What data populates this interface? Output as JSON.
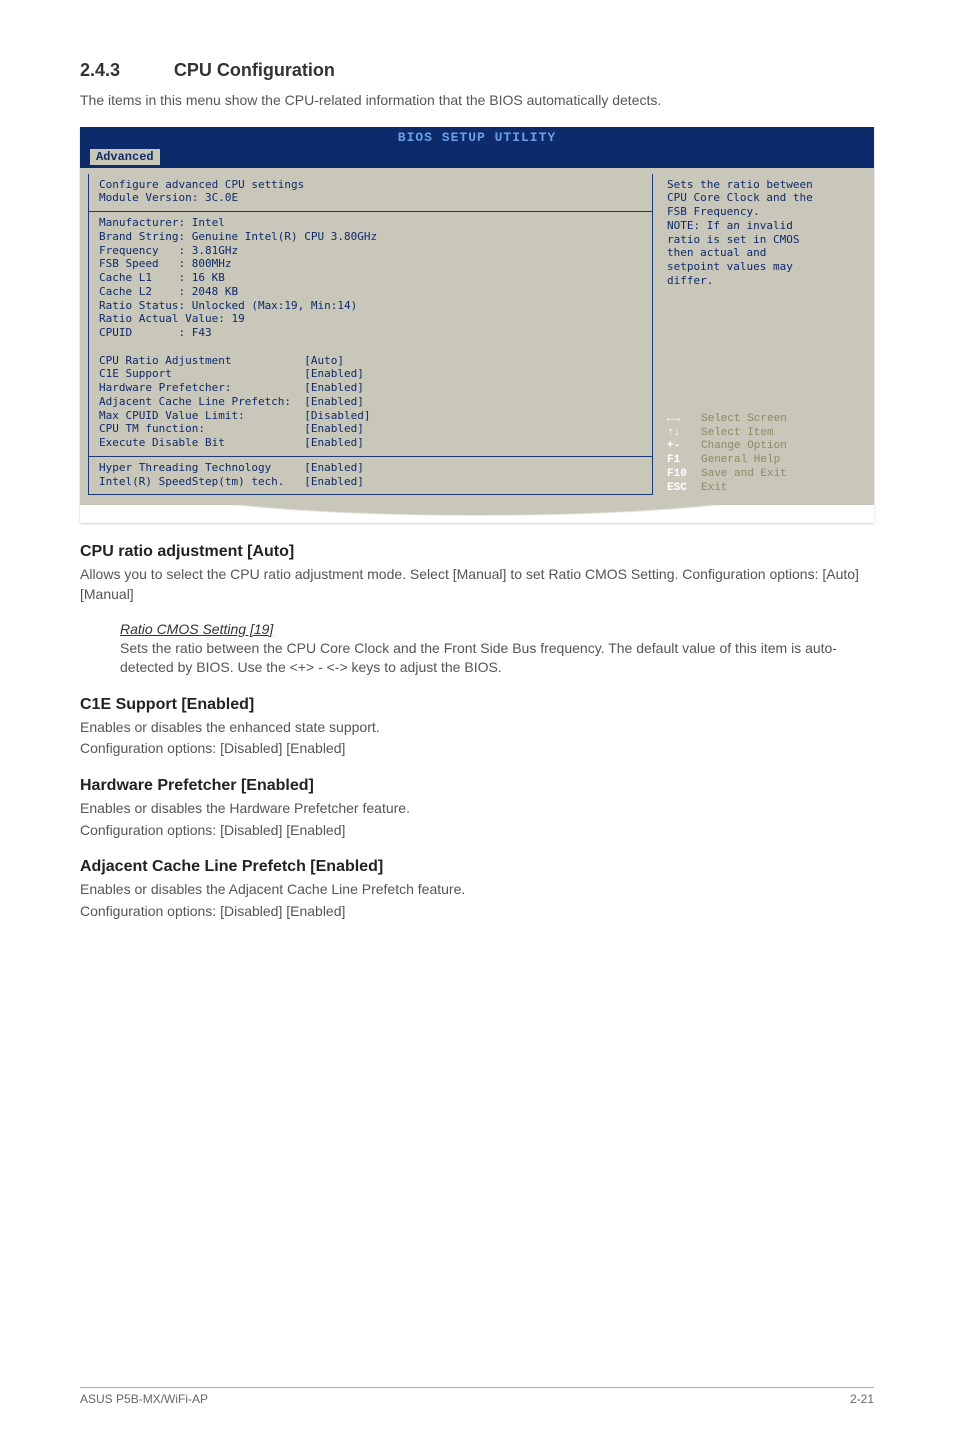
{
  "section": {
    "num": "2.4.3",
    "title": "CPU Configuration"
  },
  "intro": "The items in this menu show the CPU-related information that the BIOS automatically detects.",
  "bios": {
    "header": "BIOS SETUP UTILITY",
    "tab": "Advanced",
    "left_top": "Configure advanced CPU settings\nModule Version: 3C.0E",
    "left_info": "Manufacturer: Intel\nBrand String: Genuine Intel(R) CPU 3.80GHz\nFrequency   : 3.81GHz\nFSB Speed   : 800MHz\nCache L1    : 16 KB\nCache L2    : 2048 KB\nRatio Status: Unlocked (Max:19, Min:14)\nRatio Actual Value: 19\nCPUID       : F43\n\nCPU Ratio Adjustment           [Auto]\nC1E Support                    [Enabled]\nHardware Prefetcher:           [Enabled]\nAdjacent Cache Line Prefetch:  [Enabled]\nMax CPUID Value Limit:         [Disabled]\nCPU TM function:               [Enabled]\nExecute Disable Bit            [Enabled]",
    "left_bottom": "Hyper Threading Technology     [Enabled]\nIntel(R) SpeedStep(tm) tech.   [Enabled]",
    "help": "Sets the ratio between\nCPU Core Clock and the\nFSB Frequency.\nNOTE: If an invalid\nratio is set in CMOS\nthen actual and\nsetpoint values may\ndiffer.",
    "legend": [
      {
        "key": "←→",
        "act": "Select Screen"
      },
      {
        "key": "↑↓",
        "act": "Select Item"
      },
      {
        "key": "+-",
        "act": "Change Option"
      },
      {
        "key": "F1",
        "act": "General Help"
      },
      {
        "key": "F10",
        "act": "Save and Exit"
      },
      {
        "key": "ESC",
        "act": "Exit"
      }
    ]
  },
  "s1": {
    "head": "CPU ratio adjustment [Auto]",
    "text": "Allows you to select the CPU ratio adjustment mode. Select [Manual] to set Ratio CMOS Setting. Configuration options: [Auto] [Manual]",
    "sub_title": "Ratio CMOS Setting [19]",
    "sub_text": "Sets the ratio between the CPU Core Clock and the Front Side Bus frequency. The default value of this item is auto-detected by BIOS. Use the <+> - <-> keys to adjust the BIOS."
  },
  "s2": {
    "head": "C1E Support [Enabled]",
    "text1": "Enables or disables the enhanced state support.",
    "text2": "Configuration options: [Disabled] [Enabled]"
  },
  "s3": {
    "head": "Hardware Prefetcher [Enabled]",
    "text1": "Enables or disables the Hardware Prefetcher feature.",
    "text2": "Configuration options: [Disabled] [Enabled]"
  },
  "s4": {
    "head": "Adjacent Cache Line Prefetch [Enabled]",
    "text1": "Enables or disables the Adjacent Cache Line Prefetch feature.",
    "text2": "Configuration options: [Disabled] [Enabled]"
  },
  "footer": {
    "left": "ASUS P5B-MX/WiFi-AP",
    "right": "2-21"
  }
}
